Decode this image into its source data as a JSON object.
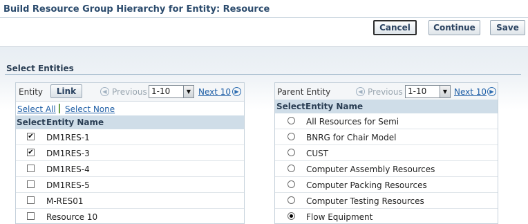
{
  "page": {
    "title": "Build Resource Group Hierarchy for Entity: Resource"
  },
  "actions": {
    "cancel_label": "Cancel",
    "continue_label": "Continue",
    "save_label": "Save"
  },
  "section": {
    "title": "Select Entities"
  },
  "left_table": {
    "nav": {
      "entity_label": "Entity",
      "link_label": "Link",
      "previous_label": "Previous",
      "range_value": "1-10",
      "next_label": "Next 10"
    },
    "select_all_label": "Select All",
    "select_none_label": "Select None",
    "header": {
      "select": "Select",
      "entity_name": "Entity Name"
    },
    "rows": [
      {
        "name": "DM1RES-1",
        "checked": true
      },
      {
        "name": "DM1RES-3",
        "checked": true
      },
      {
        "name": "DM1RES-4",
        "checked": false
      },
      {
        "name": "DM1RES-5",
        "checked": false
      },
      {
        "name": "M-RES01",
        "checked": false
      },
      {
        "name": "Resource 10",
        "checked": false
      }
    ]
  },
  "right_table": {
    "nav": {
      "parent_label": "Parent Entity",
      "previous_label": "Previous",
      "range_value": "1-10",
      "next_label": "Next 10"
    },
    "header": {
      "select": "Select",
      "entity_name": "Entity Name"
    },
    "rows": [
      {
        "name": "All Resources for Semi",
        "selected": false
      },
      {
        "name": "BNRG for Chair Model",
        "selected": false
      },
      {
        "name": "CUST",
        "selected": false
      },
      {
        "name": "Computer Assembly Resources",
        "selected": false
      },
      {
        "name": "Computer Packing Resources",
        "selected": false
      },
      {
        "name": "Computer Testing Resources",
        "selected": false
      },
      {
        "name": "Flow Equipment",
        "selected": true
      }
    ]
  },
  "icons": {
    "previous": "chevron-left-circle-icon",
    "next": "chevron-right-circle-icon",
    "dropdown": "triangle-down-icon",
    "checkbox_checked": "checkmark-icon"
  },
  "colors": {
    "link": "#1f5fa6",
    "header_bg": "#cfdde8",
    "title": "#2a4a6c"
  }
}
